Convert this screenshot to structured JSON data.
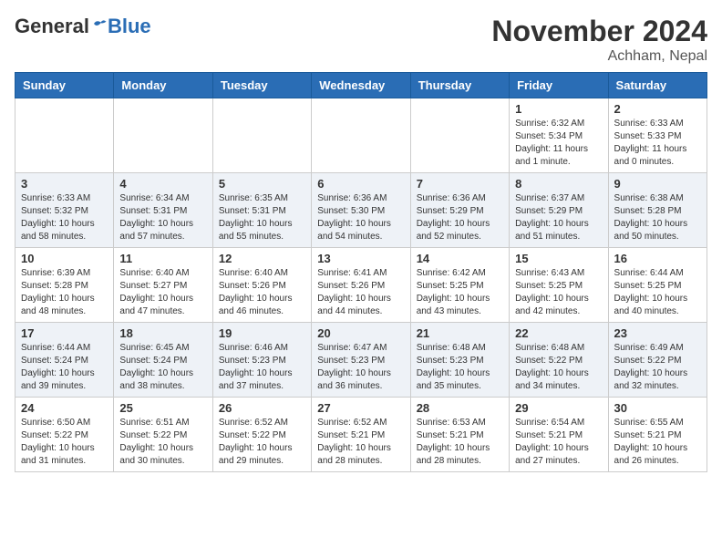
{
  "header": {
    "logo_general": "General",
    "logo_blue": "Blue",
    "month_title": "November 2024",
    "location": "Achham, Nepal"
  },
  "days_of_week": [
    "Sunday",
    "Monday",
    "Tuesday",
    "Wednesday",
    "Thursday",
    "Friday",
    "Saturday"
  ],
  "weeks": [
    [
      {
        "day": "",
        "info": ""
      },
      {
        "day": "",
        "info": ""
      },
      {
        "day": "",
        "info": ""
      },
      {
        "day": "",
        "info": ""
      },
      {
        "day": "",
        "info": ""
      },
      {
        "day": "1",
        "info": "Sunrise: 6:32 AM\nSunset: 5:34 PM\nDaylight: 11 hours and 1 minute."
      },
      {
        "day": "2",
        "info": "Sunrise: 6:33 AM\nSunset: 5:33 PM\nDaylight: 11 hours and 0 minutes."
      }
    ],
    [
      {
        "day": "3",
        "info": "Sunrise: 6:33 AM\nSunset: 5:32 PM\nDaylight: 10 hours and 58 minutes."
      },
      {
        "day": "4",
        "info": "Sunrise: 6:34 AM\nSunset: 5:31 PM\nDaylight: 10 hours and 57 minutes."
      },
      {
        "day": "5",
        "info": "Sunrise: 6:35 AM\nSunset: 5:31 PM\nDaylight: 10 hours and 55 minutes."
      },
      {
        "day": "6",
        "info": "Sunrise: 6:36 AM\nSunset: 5:30 PM\nDaylight: 10 hours and 54 minutes."
      },
      {
        "day": "7",
        "info": "Sunrise: 6:36 AM\nSunset: 5:29 PM\nDaylight: 10 hours and 52 minutes."
      },
      {
        "day": "8",
        "info": "Sunrise: 6:37 AM\nSunset: 5:29 PM\nDaylight: 10 hours and 51 minutes."
      },
      {
        "day": "9",
        "info": "Sunrise: 6:38 AM\nSunset: 5:28 PM\nDaylight: 10 hours and 50 minutes."
      }
    ],
    [
      {
        "day": "10",
        "info": "Sunrise: 6:39 AM\nSunset: 5:28 PM\nDaylight: 10 hours and 48 minutes."
      },
      {
        "day": "11",
        "info": "Sunrise: 6:40 AM\nSunset: 5:27 PM\nDaylight: 10 hours and 47 minutes."
      },
      {
        "day": "12",
        "info": "Sunrise: 6:40 AM\nSunset: 5:26 PM\nDaylight: 10 hours and 46 minutes."
      },
      {
        "day": "13",
        "info": "Sunrise: 6:41 AM\nSunset: 5:26 PM\nDaylight: 10 hours and 44 minutes."
      },
      {
        "day": "14",
        "info": "Sunrise: 6:42 AM\nSunset: 5:25 PM\nDaylight: 10 hours and 43 minutes."
      },
      {
        "day": "15",
        "info": "Sunrise: 6:43 AM\nSunset: 5:25 PM\nDaylight: 10 hours and 42 minutes."
      },
      {
        "day": "16",
        "info": "Sunrise: 6:44 AM\nSunset: 5:25 PM\nDaylight: 10 hours and 40 minutes."
      }
    ],
    [
      {
        "day": "17",
        "info": "Sunrise: 6:44 AM\nSunset: 5:24 PM\nDaylight: 10 hours and 39 minutes."
      },
      {
        "day": "18",
        "info": "Sunrise: 6:45 AM\nSunset: 5:24 PM\nDaylight: 10 hours and 38 minutes."
      },
      {
        "day": "19",
        "info": "Sunrise: 6:46 AM\nSunset: 5:23 PM\nDaylight: 10 hours and 37 minutes."
      },
      {
        "day": "20",
        "info": "Sunrise: 6:47 AM\nSunset: 5:23 PM\nDaylight: 10 hours and 36 minutes."
      },
      {
        "day": "21",
        "info": "Sunrise: 6:48 AM\nSunset: 5:23 PM\nDaylight: 10 hours and 35 minutes."
      },
      {
        "day": "22",
        "info": "Sunrise: 6:48 AM\nSunset: 5:22 PM\nDaylight: 10 hours and 34 minutes."
      },
      {
        "day": "23",
        "info": "Sunrise: 6:49 AM\nSunset: 5:22 PM\nDaylight: 10 hours and 32 minutes."
      }
    ],
    [
      {
        "day": "24",
        "info": "Sunrise: 6:50 AM\nSunset: 5:22 PM\nDaylight: 10 hours and 31 minutes."
      },
      {
        "day": "25",
        "info": "Sunrise: 6:51 AM\nSunset: 5:22 PM\nDaylight: 10 hours and 30 minutes."
      },
      {
        "day": "26",
        "info": "Sunrise: 6:52 AM\nSunset: 5:22 PM\nDaylight: 10 hours and 29 minutes."
      },
      {
        "day": "27",
        "info": "Sunrise: 6:52 AM\nSunset: 5:21 PM\nDaylight: 10 hours and 28 minutes."
      },
      {
        "day": "28",
        "info": "Sunrise: 6:53 AM\nSunset: 5:21 PM\nDaylight: 10 hours and 28 minutes."
      },
      {
        "day": "29",
        "info": "Sunrise: 6:54 AM\nSunset: 5:21 PM\nDaylight: 10 hours and 27 minutes."
      },
      {
        "day": "30",
        "info": "Sunrise: 6:55 AM\nSunset: 5:21 PM\nDaylight: 10 hours and 26 minutes."
      }
    ]
  ]
}
